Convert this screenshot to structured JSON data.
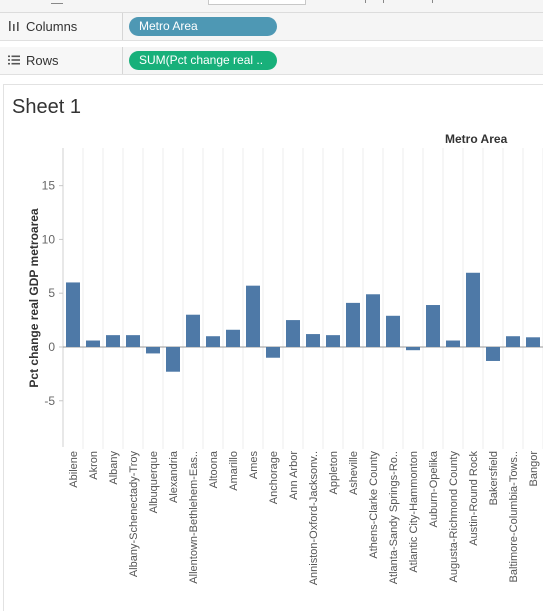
{
  "shelves": {
    "columns": {
      "label": "Columns",
      "pill": "Metro Area",
      "icon": "columns-icon"
    },
    "rows": {
      "label": "Rows",
      "pill": "SUM(Pct change real ..",
      "icon": "rows-icon"
    }
  },
  "sheet": {
    "title": "Sheet 1"
  },
  "colors": {
    "bar": "#4e79a7",
    "dimension_pill": "#4e98b4",
    "measure_pill": "#18b07a"
  },
  "chart_data": {
    "type": "bar",
    "title": "Metro Area",
    "xlabel": "",
    "ylabel": "Pct change real GDP metroarea",
    "ylim": [
      -9.3,
      18.5
    ],
    "yticks": [
      15,
      10,
      5,
      0,
      -5
    ],
    "ytick_labels": [
      "15",
      "10",
      "5",
      "0",
      "-5"
    ],
    "grid": false,
    "categories": [
      "Abilene",
      "Akron",
      "Albany",
      "Albany-Schenectady-Troy",
      "Albuquerque",
      "Alexandria",
      "Allentown-Bethlehem-Eas..",
      "Altoona",
      "Amarillo",
      "Ames",
      "Anchorage",
      "Ann Arbor",
      "Anniston-Oxford-Jacksonv..",
      "Appleton",
      "Asheville",
      "Athens-Clarke County",
      "Atlanta-Sandy Springs-Ro..",
      "Atlantic City-Hammonton",
      "Auburn-Opelika",
      "Augusta-Richmond County",
      "Austin-Round Rock",
      "Bakersfield",
      "Baltimore-Columbia-Tows..",
      "Bangor"
    ],
    "values": [
      6.0,
      0.6,
      1.1,
      1.1,
      -0.6,
      -2.3,
      3.0,
      1.0,
      1.6,
      5.7,
      -1.0,
      2.5,
      1.2,
      1.1,
      4.1,
      4.9,
      2.9,
      -0.3,
      3.9,
      0.6,
      6.9,
      -1.3,
      1.0,
      0.9
    ]
  }
}
